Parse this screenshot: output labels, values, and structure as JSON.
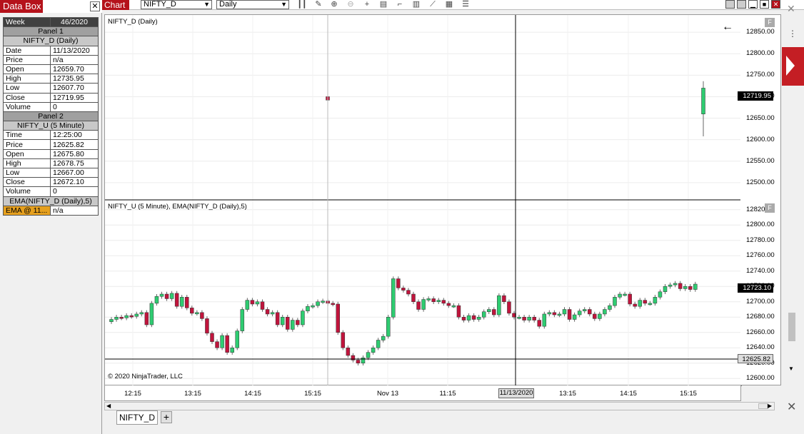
{
  "databox": {
    "title": "Data Box",
    "close": "✕",
    "week_label": "Week",
    "week_value": "46/2020",
    "panel1": "Panel 1",
    "panel1_inst": "NIFTY_D (Daily)",
    "panel1_rows": [
      {
        "label": "Date",
        "value": "11/13/2020"
      },
      {
        "label": "Price",
        "value": "n/a"
      },
      {
        "label": "Open",
        "value": "12659.70"
      },
      {
        "label": "High",
        "value": "12735.95"
      },
      {
        "label": "Low",
        "value": "12607.70"
      },
      {
        "label": "Close",
        "value": "12719.95"
      },
      {
        "label": "Volume",
        "value": "0"
      }
    ],
    "panel2": "Panel 2",
    "panel2_inst": "NIFTY_U (5 Minute)",
    "panel2_rows": [
      {
        "label": "Time",
        "value": "12:25:00"
      },
      {
        "label": "Price",
        "value": "12625.82"
      },
      {
        "label": "Open",
        "value": "12675.80"
      },
      {
        "label": "High",
        "value": "12678.75"
      },
      {
        "label": "Low",
        "value": "12667.00"
      },
      {
        "label": "Close",
        "value": "12672.10"
      },
      {
        "label": "Volume",
        "value": "0"
      }
    ],
    "ema_title": "EMA(NIFTY_D (Daily),5)",
    "ema_label": "EMA @ 11...",
    "ema_value": "n/a"
  },
  "chart": {
    "title": "Chart",
    "instrument": "NIFTY_D",
    "period": "Daily",
    "panel1_label": "NIFTY_D (Daily)",
    "panel2_label": "NIFTY_U (5 Minute), EMA(NIFTY_D (Daily),5)",
    "copyright": "© 2020 NinjaTrader, LLC",
    "panel1_price_marker": "12719.95",
    "panel2_price_marker": "12723.10",
    "crosshair_price": "12625.82",
    "crosshair_date": "11/13/2020",
    "panel1_yticks": [
      "12850.00",
      "12800.00",
      "12750.00",
      "12700.00",
      "12650.00",
      "12600.00",
      "12550.00",
      "12500.00"
    ],
    "panel2_yticks": [
      "12820.00",
      "12800.00",
      "12780.00",
      "12760.00",
      "12740.00",
      "12720.00",
      "12700.00",
      "12680.00",
      "12660.00",
      "12640.00",
      "12620.00",
      "12600.00"
    ],
    "xticks": [
      "12:15",
      "13:15",
      "14:15",
      "15:15",
      "Nov 13",
      "11:15",
      "13:15",
      "14:15",
      "15:15"
    ],
    "tab": "NIFTY_D",
    "add_tab": "+",
    "panel_btn": "F"
  },
  "chart_data": {
    "type": "candlestick",
    "panel1": {
      "ylim": [
        12460,
        12890
      ],
      "candles": [
        {
          "o": 12700,
          "h": 12702,
          "l": 12690,
          "c": 12692
        },
        {
          "o": 12659.7,
          "h": 12735.95,
          "l": 12607.7,
          "c": 12719.95
        }
      ]
    },
    "panel2": {
      "ylim": [
        12590,
        12830
      ],
      "closes": [
        12677,
        12680,
        12679,
        12682,
        12681,
        12684,
        12686,
        12670,
        12698,
        12707,
        12710,
        12704,
        12711,
        12694,
        12706,
        12692,
        12685,
        12686,
        12678,
        12659,
        12648,
        12640,
        12656,
        12634,
        12640,
        12662,
        12690,
        12702,
        12697,
        12700,
        12690,
        12684,
        12686,
        12670,
        12680,
        12664,
        12676,
        12670,
        12688,
        12694,
        12695,
        12700,
        12701,
        12698,
        12697,
        12660,
        12640,
        12630,
        12624,
        12620,
        12627,
        12634,
        12640,
        12650,
        12655,
        12680,
        12730,
        12718,
        12715,
        12710,
        12700,
        12690,
        12703,
        12704,
        12700,
        12702,
        12698,
        12695,
        12695,
        12680,
        12676,
        12682,
        12677,
        12680,
        12687,
        12690,
        12683,
        12708,
        12700,
        12685,
        12680,
        12680,
        12676,
        12680,
        12676,
        12668,
        12684,
        12686,
        12683,
        12684,
        12690,
        12677,
        12683,
        12688,
        12690,
        12684,
        12678,
        12684,
        12690,
        12695,
        12706,
        12710,
        12710,
        12697,
        12694,
        12702,
        12698,
        12698,
        12706,
        12713,
        12720,
        12722,
        12724,
        12717,
        12720,
        12716,
        12723
      ]
    }
  }
}
